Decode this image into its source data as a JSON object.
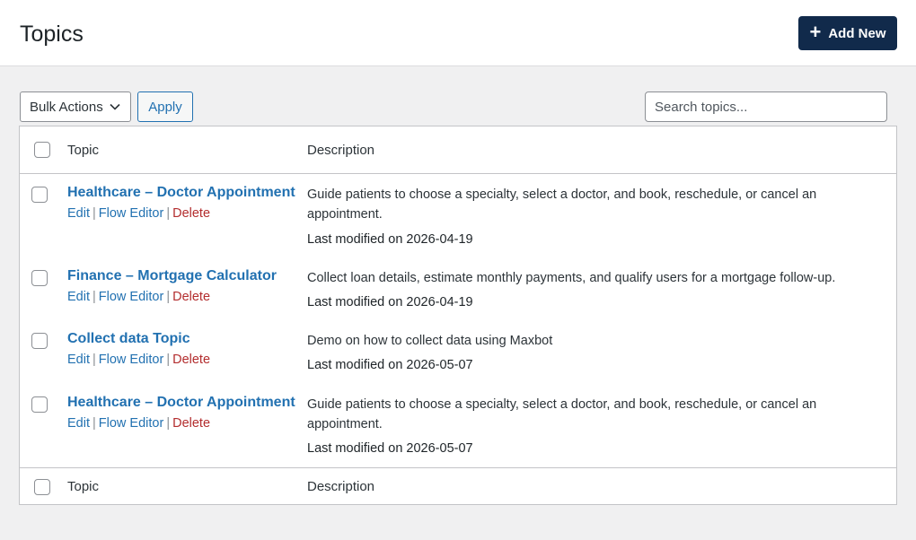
{
  "header": {
    "title": "Topics",
    "add_new_label": "Add New"
  },
  "toolbar": {
    "bulk_actions_label": "Bulk Actions",
    "apply_label": "Apply",
    "search_placeholder": "Search topics..."
  },
  "table": {
    "columns": [
      "Topic",
      "Description"
    ],
    "row_actions": {
      "edit": "Edit",
      "flow_editor": "Flow Editor",
      "delete": "Delete",
      "separator": "|"
    },
    "rows": [
      {
        "title": "Healthcare – Doctor Appointment",
        "description": "Guide patients to choose a specialty, select a doctor, and book, reschedule, or cancel an appointment.",
        "modified": "Last modified on 2026-04-19"
      },
      {
        "title": "Finance – Mortgage Calculator",
        "description": "Collect loan details, estimate monthly payments, and qualify users for a mortgage follow-up.",
        "modified": "Last modified on 2026-04-19"
      },
      {
        "title": "Collect data Topic",
        "description": "Demo on how to collect data using Maxbot",
        "modified": "Last modified on 2026-05-07"
      },
      {
        "title": "Healthcare – Doctor Appointment",
        "description": "Guide patients to choose a specialty, select a doctor, and book, reschedule, or cancel an appointment.",
        "modified": "Last modified on 2026-05-07"
      }
    ]
  },
  "colors": {
    "primary_button": "#112a4b",
    "link": "#2271b1",
    "delete": "#b32d2e",
    "background": "#f0f0f1"
  }
}
